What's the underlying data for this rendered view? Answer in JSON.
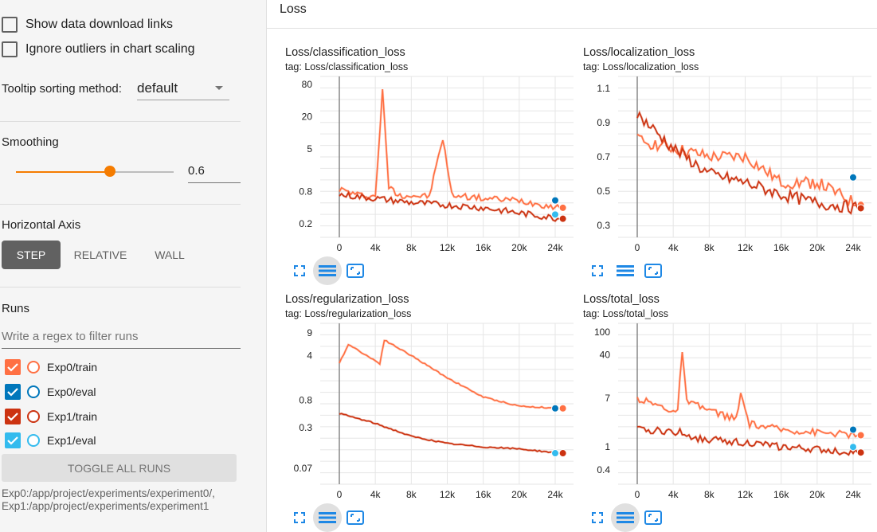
{
  "sidebar": {
    "show_download_label": "Show data download links",
    "ignore_outliers_label": "Ignore outliers in chart scaling",
    "tooltip_label": "Tooltip sorting method:",
    "tooltip_value": "default",
    "smoothing_label": "Smoothing",
    "smoothing_value": "0.6",
    "smoothing_fraction": 0.6,
    "axis_label": "Horizontal Axis",
    "axis_options": [
      "STEP",
      "RELATIVE",
      "WALL"
    ],
    "runs_label": "Runs",
    "regex_placeholder": "Write a regex to filter runs",
    "runs": [
      {
        "name": "Exp0/train",
        "color": "#ff7043"
      },
      {
        "name": "Exp0/eval",
        "color": "#0077bb"
      },
      {
        "name": "Exp1/train",
        "color": "#cc3311"
      },
      {
        "name": "Exp1/eval",
        "color": "#33bbee"
      }
    ],
    "toggle_label": "TOGGLE ALL RUNS",
    "paths": [
      "Exp0:/app/project/experiments/experiment0/,",
      "Exp1:/app/project/experiments/experiment1"
    ]
  },
  "main": {
    "section_title": "Loss"
  },
  "icons": [
    "fullscreen-icon",
    "log-scale-icon",
    "fit-domain-icon"
  ],
  "chart_data": [
    {
      "type": "line",
      "title": "Loss/classification_loss",
      "tag": "tag: Loss/classification_loss",
      "x_ticks": [
        "0",
        "4k",
        "8k",
        "12k",
        "16k",
        "20k",
        "24k"
      ],
      "y_ticks": [
        "80",
        "20",
        "5",
        "0.8",
        "0.2"
      ],
      "y_scale": "log",
      "series": [
        {
          "color": "#ff7043",
          "values": [
            [
              0,
              0.9
            ],
            [
              2000,
              0.7
            ],
            [
              4000,
              0.65
            ],
            [
              4800,
              60
            ],
            [
              5500,
              1.0
            ],
            [
              6500,
              0.7
            ],
            [
              10000,
              0.65
            ],
            [
              11500,
              8
            ],
            [
              12500,
              0.7
            ],
            [
              16000,
              0.6
            ],
            [
              20000,
              0.55
            ],
            [
              24500,
              0.4
            ]
          ]
        },
        {
          "color": "#cc3311",
          "values": [
            [
              0,
              0.7
            ],
            [
              4000,
              0.6
            ],
            [
              8000,
              0.5
            ],
            [
              12000,
              0.45
            ],
            [
              16000,
              0.4
            ],
            [
              20000,
              0.32
            ],
            [
              24500,
              0.25
            ]
          ]
        },
        {
          "color": "#0077bb",
          "values": [
            [
              24000,
              0.55
            ]
          ]
        },
        {
          "color": "#33bbee",
          "values": [
            [
              24000,
              0.3
            ]
          ]
        }
      ]
    },
    {
      "type": "line",
      "title": "Loss/localization_loss",
      "tag": "tag: Loss/localization_loss",
      "x_ticks": [
        "0",
        "4k",
        "8k",
        "12k",
        "16k",
        "20k",
        "24k"
      ],
      "y_ticks": [
        "1.1",
        "0.9",
        "0.7",
        "0.5",
        "0.3"
      ],
      "series": [
        {
          "color": "#ff7043",
          "values": [
            [
              0,
              0.8
            ],
            [
              4000,
              0.75
            ],
            [
              8000,
              0.7
            ],
            [
              12000,
              0.7
            ],
            [
              16000,
              0.55
            ],
            [
              20000,
              0.55
            ],
            [
              24500,
              0.42
            ]
          ]
        },
        {
          "color": "#cc3311",
          "values": [
            [
              0,
              0.95
            ],
            [
              4000,
              0.75
            ],
            [
              8000,
              0.6
            ],
            [
              12000,
              0.55
            ],
            [
              16000,
              0.48
            ],
            [
              20000,
              0.43
            ],
            [
              24500,
              0.4
            ]
          ]
        },
        {
          "color": "#0077bb",
          "values": [
            [
              24000,
              0.58
            ]
          ]
        }
      ]
    },
    {
      "type": "line",
      "title": "Loss/regularization_loss",
      "tag": "tag: Loss/regularization_loss",
      "x_ticks": [
        "0",
        "4k",
        "8k",
        "12k",
        "16k",
        "20k",
        "24k"
      ],
      "y_ticks": [
        "9",
        "4",
        "0.8",
        "0.3",
        "0.07"
      ],
      "y_scale": "log",
      "series": [
        {
          "color": "#ff7043",
          "values": [
            [
              0,
              3
            ],
            [
              1000,
              6
            ],
            [
              4500,
              3
            ],
            [
              5000,
              7
            ],
            [
              8000,
              4
            ],
            [
              12000,
              1.8
            ],
            [
              16000,
              0.9
            ],
            [
              20000,
              0.65
            ],
            [
              24500,
              0.6
            ]
          ]
        },
        {
          "color": "#cc3311",
          "values": [
            [
              0,
              0.5
            ],
            [
              4000,
              0.35
            ],
            [
              8000,
              0.22
            ],
            [
              12000,
              0.17
            ],
            [
              16000,
              0.15
            ],
            [
              20000,
              0.14
            ],
            [
              24500,
              0.12
            ]
          ]
        },
        {
          "color": "#0077bb",
          "values": [
            [
              24000,
              0.6
            ]
          ]
        },
        {
          "color": "#33bbee",
          "values": [
            [
              24000,
              0.12
            ]
          ]
        }
      ]
    },
    {
      "type": "line",
      "title": "Loss/total_loss",
      "tag": "tag: Loss/total_loss",
      "x_ticks": [
        "0",
        "4k",
        "8k",
        "12k",
        "16k",
        "20k",
        "24k"
      ],
      "y_ticks": [
        "100",
        "40",
        "7",
        "1",
        "0.4"
      ],
      "y_scale": "log",
      "series": [
        {
          "color": "#ff7043",
          "values": [
            [
              0,
              7
            ],
            [
              4500,
              4
            ],
            [
              5000,
              50
            ],
            [
              5500,
              6
            ],
            [
              11000,
              3
            ],
            [
              11500,
              8
            ],
            [
              12500,
              2.5
            ],
            [
              16000,
              2
            ],
            [
              20000,
              1.8
            ],
            [
              24500,
              1.6
            ]
          ]
        },
        {
          "color": "#cc3311",
          "values": [
            [
              0,
              2
            ],
            [
              5000,
              1.8
            ],
            [
              6500,
              1.4
            ],
            [
              12000,
              1.2
            ],
            [
              16000,
              1.0
            ],
            [
              20000,
              0.9
            ],
            [
              24500,
              0.8
            ]
          ]
        },
        {
          "color": "#0077bb",
          "values": [
            [
              24000,
              2.0
            ]
          ]
        },
        {
          "color": "#33bbee",
          "values": [
            [
              24000,
              1.0
            ]
          ]
        }
      ]
    }
  ]
}
